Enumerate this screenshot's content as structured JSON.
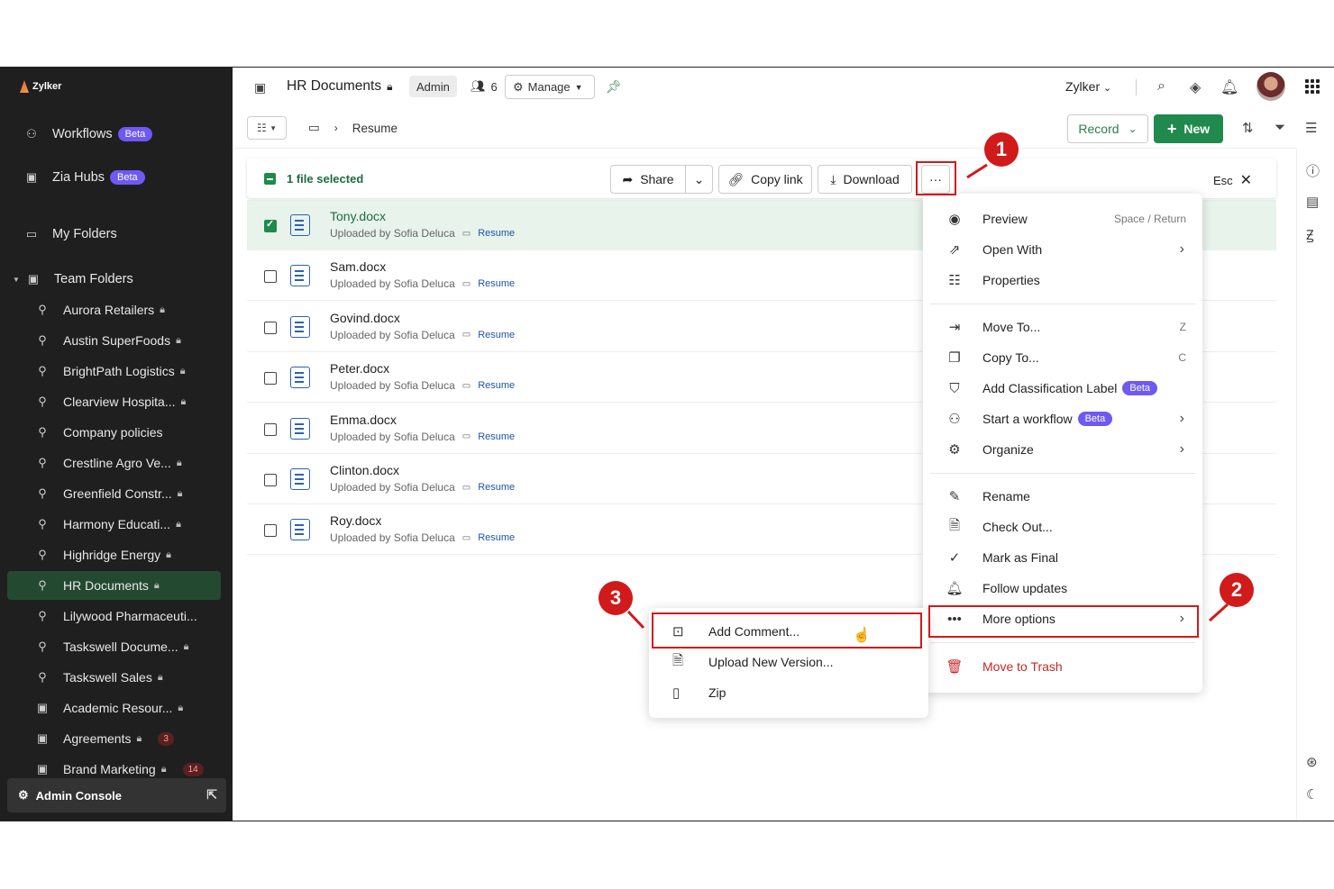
{
  "sidebar": {
    "brand": "Zylker",
    "top_items": [
      {
        "label": "Workflows",
        "badge": "Beta",
        "icon": "workflow-icon"
      },
      {
        "label": "Zia Hubs",
        "badge": "Beta",
        "icon": "zia-hub-icon"
      },
      {
        "label": "My Folders",
        "icon": "folder-icon"
      },
      {
        "label": "Team Folders",
        "icon": "team-folder-icon"
      }
    ],
    "team_folders": [
      {
        "label": "Aurora Retailers",
        "locked": true
      },
      {
        "label": "Austin SuperFoods",
        "locked": true
      },
      {
        "label": "BrightPath Logistics",
        "locked": true
      },
      {
        "label": "Clearview Hospita...",
        "locked": true
      },
      {
        "label": "Company policies",
        "locked": false
      },
      {
        "label": "Crestline Agro Ve...",
        "locked": true
      },
      {
        "label": "Greenfield Constr...",
        "locked": true
      },
      {
        "label": "Harmony Educati...",
        "locked": true
      },
      {
        "label": "Highridge Energy",
        "locked": true
      },
      {
        "label": "HR Documents",
        "locked": true,
        "active": true
      },
      {
        "label": "Lilywood Pharmaceuti...",
        "locked": false
      },
      {
        "label": "Taskswell Docume...",
        "locked": true
      },
      {
        "label": "Taskswell Sales",
        "locked": true
      },
      {
        "label": "Academic Resour...",
        "locked": true
      },
      {
        "label": "Agreements",
        "locked": true,
        "count": "3"
      },
      {
        "label": "Brand Marketing",
        "locked": true,
        "count": "14"
      }
    ],
    "admin_console": "Admin Console"
  },
  "topbar": {
    "title": "HR Documents",
    "role": "Admin",
    "members": "6",
    "manage": "Manage",
    "user": "Zylker"
  },
  "toolbar": {
    "breadcrumb": "Resume",
    "record": "Record",
    "new": "New"
  },
  "selection": {
    "label": "1 file selected",
    "share": "Share",
    "copy_link": "Copy link",
    "download": "Download",
    "more": "···",
    "esc": "Esc"
  },
  "files": [
    {
      "name": "Tony.docx",
      "meta": "Uploaded by Sofia Deluca",
      "folder": "Resume",
      "selected": true
    },
    {
      "name": "Sam.docx",
      "meta": "Uploaded by Sofia Deluca",
      "folder": "Resume",
      "selected": false
    },
    {
      "name": "Govind.docx",
      "meta": "Uploaded by Sofia Deluca",
      "folder": "Resume",
      "selected": false
    },
    {
      "name": "Peter.docx",
      "meta": "Uploaded by Sofia Deluca",
      "folder": "Resume",
      "selected": false
    },
    {
      "name": "Emma.docx",
      "meta": "Uploaded by Sofia Deluca",
      "folder": "Resume",
      "selected": false
    },
    {
      "name": "Clinton.docx",
      "meta": "Uploaded by Sofia Deluca",
      "folder": "Resume",
      "selected": false
    },
    {
      "name": "Roy.docx",
      "meta": "Uploaded by Sofia Deluca",
      "folder": "Resume",
      "selected": false
    }
  ],
  "menu": {
    "preview": "Preview",
    "preview_shortcut": "Space / Return",
    "open_with": "Open With",
    "properties": "Properties",
    "move_to": "Move To...",
    "move_shortcut": "Z",
    "copy_to": "Copy To...",
    "copy_shortcut": "C",
    "classification": "Add Classification Label",
    "classification_badge": "Beta",
    "workflow": "Start a workflow",
    "workflow_badge": "Beta",
    "organize": "Organize",
    "rename": "Rename",
    "check_out": "Check Out...",
    "mark_final": "Mark as Final",
    "follow": "Follow updates",
    "more_options": "More options",
    "trash": "Move to Trash"
  },
  "submenu": {
    "add_comment": "Add Comment...",
    "upload_version": "Upload New Version...",
    "zip": "Zip"
  },
  "annotations": {
    "step1": "1",
    "step2": "2",
    "step3": "3"
  },
  "colors": {
    "accent": "#1f8a4c",
    "annotation": "#d11a1a",
    "beta": "#6e59f5"
  }
}
